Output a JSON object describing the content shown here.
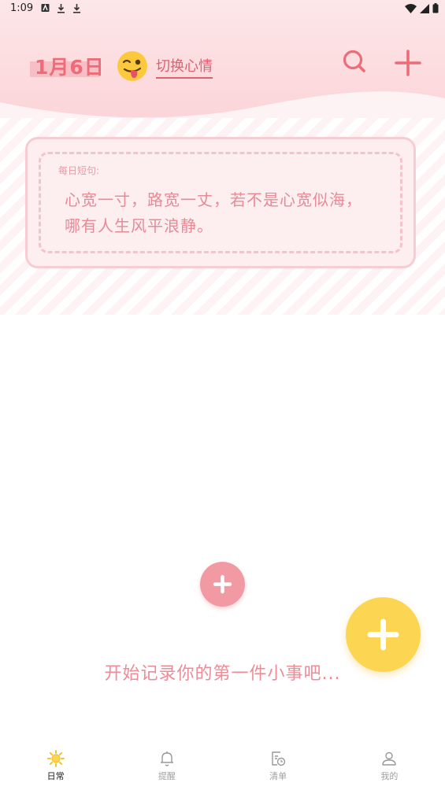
{
  "status_bar": {
    "time": "1:09"
  },
  "header": {
    "date": "1月6日",
    "mood_switch_label": "切换心情"
  },
  "quote": {
    "label": "每日短句:",
    "line1": "心宽一寸，路宽一丈，若不是心宽似海，",
    "line2": "哪有人生风平浪静。"
  },
  "empty_state": {
    "text": "开始记录你的第一件小事吧..."
  },
  "bottom_nav": {
    "items": [
      {
        "label": "日常",
        "icon": "sun-icon",
        "active": true
      },
      {
        "label": "提醒",
        "icon": "bell-icon",
        "active": false
      },
      {
        "label": "清单",
        "icon": "checklist-clock-icon",
        "active": false
      },
      {
        "label": "我的",
        "icon": "user-icon",
        "active": false
      }
    ]
  },
  "colors": {
    "accent": "#ec6c7a",
    "header_bg": "#fbd4d8",
    "fab_yellow": "#fcd553",
    "empty_add_pink": "#f29aa4"
  }
}
